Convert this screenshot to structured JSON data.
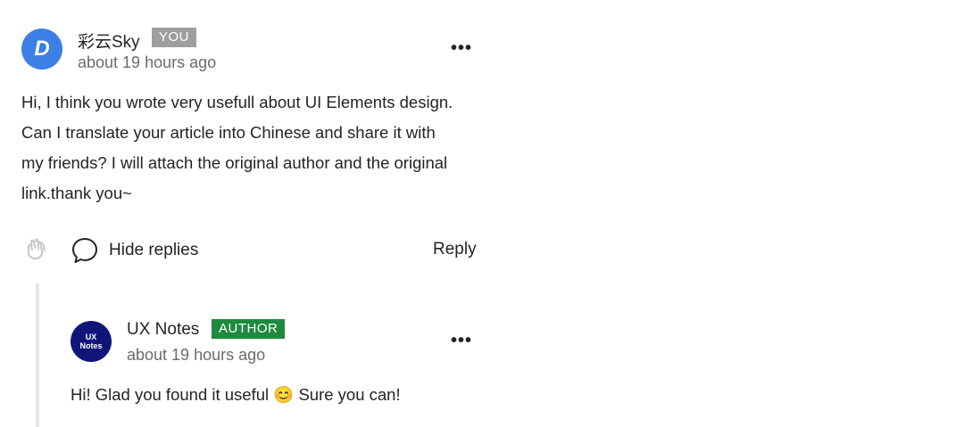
{
  "comment": {
    "avatar_letter": "D",
    "author": "彩云Sky",
    "badge": "YOU",
    "time": "about 19 hours ago",
    "more_label": "•••",
    "body_lines": [
      "Hi, I think you wrote very usefull about UI Elements design.",
      "Can I translate your article into Chinese and share it with",
      "my friends? I will attach the original author and the original",
      "link.thank you~"
    ],
    "hide_replies_label": "Hide replies",
    "reply_label": "Reply"
  },
  "reply": {
    "avatar_text_1": "UX",
    "avatar_text_2": "Notes",
    "author": "UX Notes",
    "badge": "AUTHOR",
    "time": "about 19 hours ago",
    "more_label": "•••",
    "body": "Hi! Glad you found it useful 😊 Sure you can!"
  },
  "icons": {
    "clap": "clap-icon",
    "speech": "speech-bubble-icon"
  },
  "colors": {
    "avatar_blue": "#3d7fe6",
    "you_badge": "#9e9e9e",
    "author_badge": "#1e8a3e",
    "ux_avatar": "#11157a"
  }
}
